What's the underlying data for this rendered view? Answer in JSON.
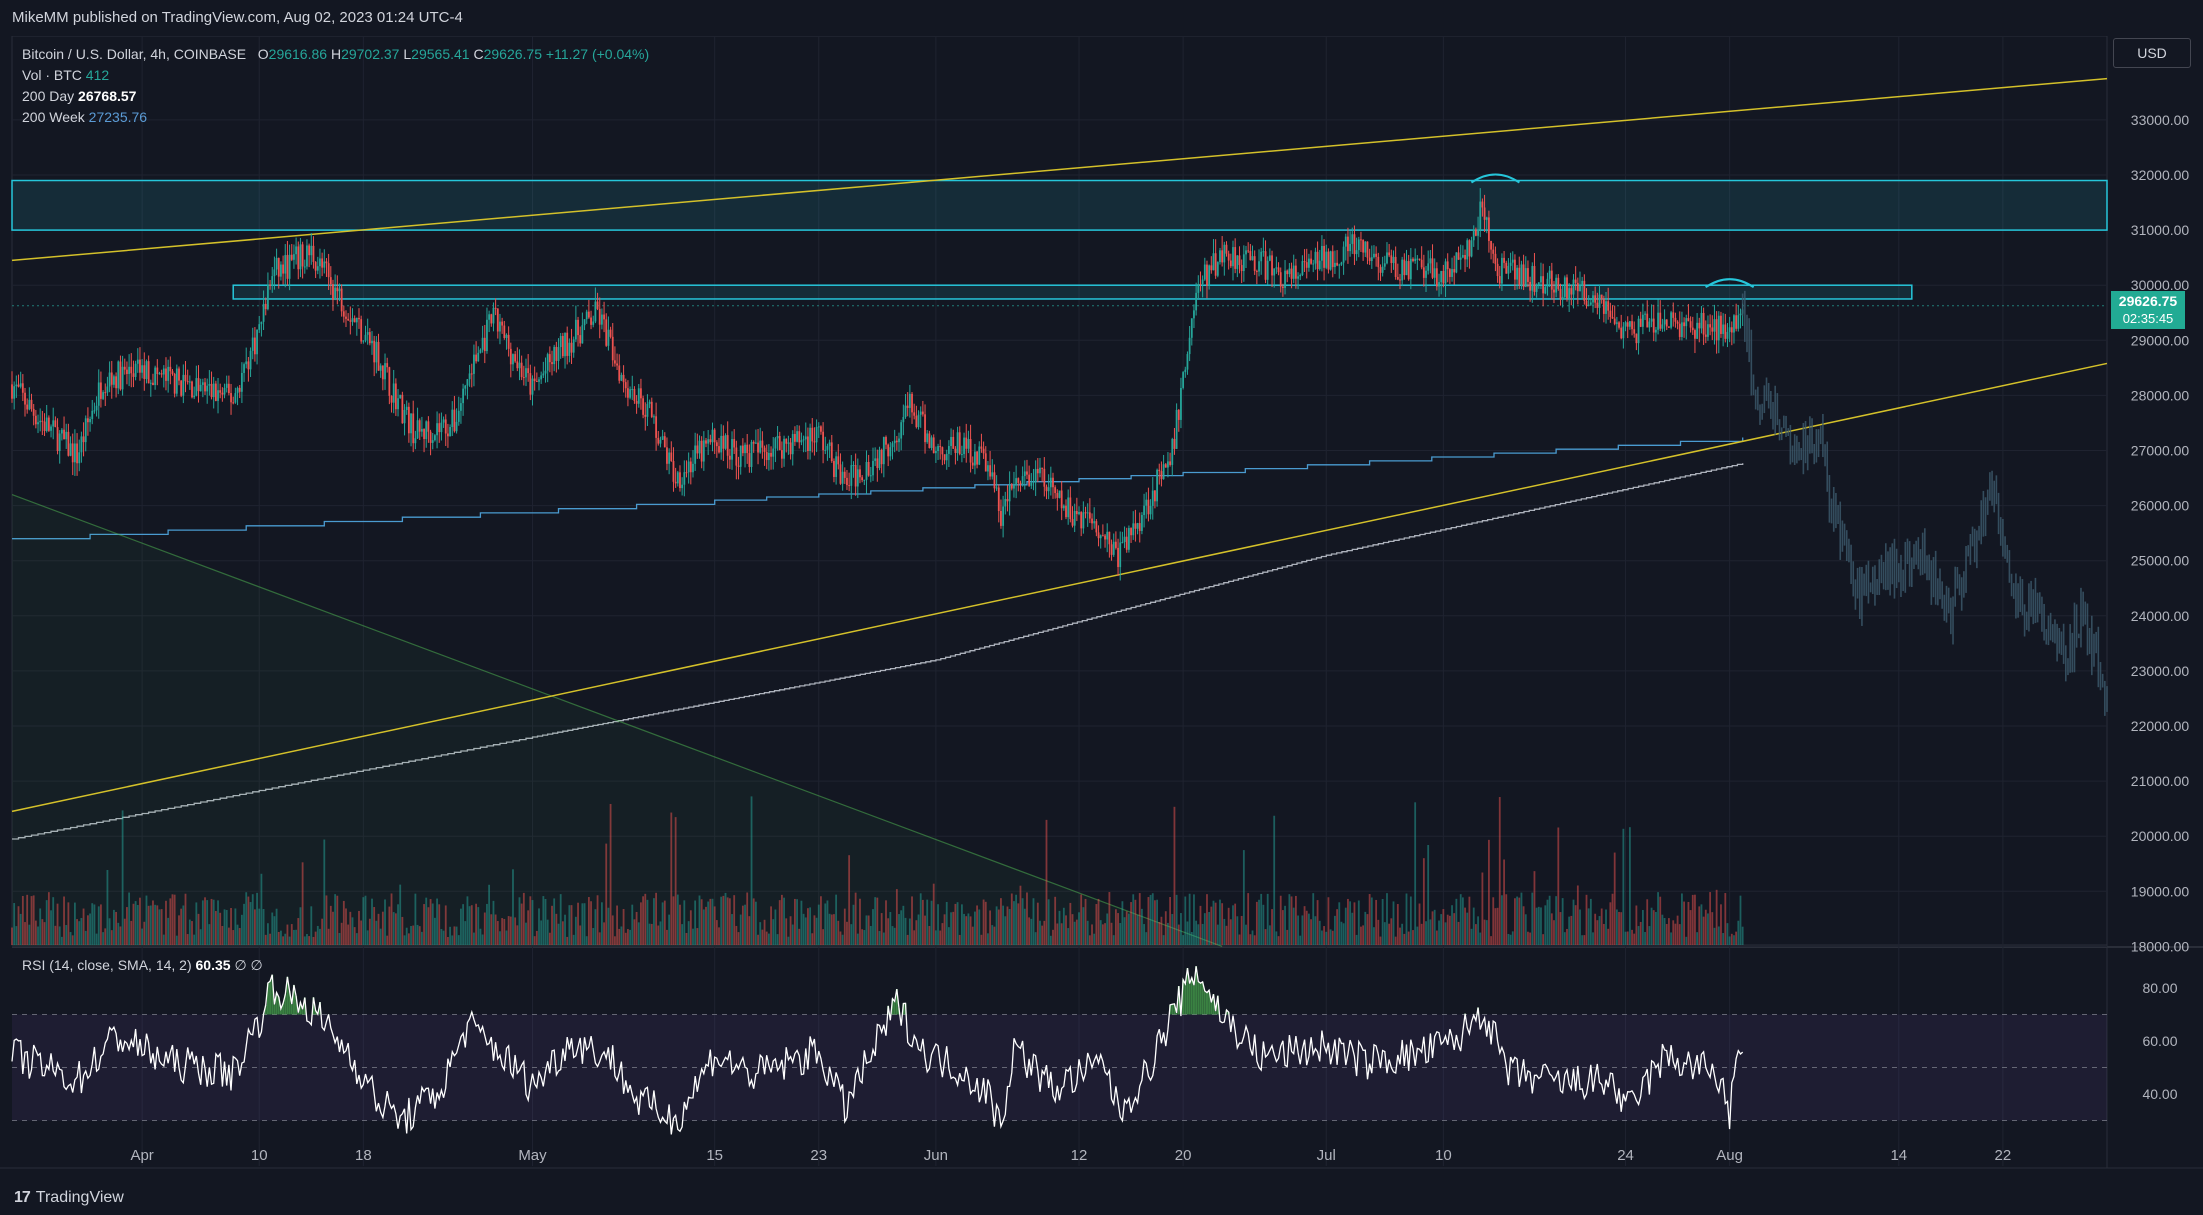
{
  "header": {
    "published": "MikeMM published on TradingView.com, Aug 02, 2023 01:24 UTC-4"
  },
  "legend": {
    "symbol": "Bitcoin / U.S. Dollar, 4h, COINBASE",
    "o_label": "O",
    "o_value": "29616.86",
    "h_label": "H",
    "h_value": "29702.37",
    "l_label": "L",
    "l_value": "29565.41",
    "c_label": "C",
    "c_value": "29626.75",
    "change": "+11.27 (+0.04%)",
    "vol_label": "Vol · BTC",
    "vol_value": "412",
    "ma200d_label": "200 Day",
    "ma200d_value": "26768.57",
    "ma200w_label": "200 Week",
    "ma200w_value": "27235.76"
  },
  "rsi_legend": {
    "label": "RSI (14, close, SMA, 14, 2)",
    "value": "60.35",
    "extra": "∅ ∅"
  },
  "currency": "USD",
  "price_tag": {
    "price": "29626.75",
    "countdown": "02:35:45"
  },
  "footer": {
    "logo": "17",
    "brand": "TradingView"
  },
  "colors": {
    "background": "#131722",
    "up": "#26a69a",
    "down": "#ef5350",
    "zone": "#26c6da",
    "trendline": "#d4c12a",
    "ma200w": "#4a9bd0",
    "ma200d": "#c8ccd6",
    "rsi": "#ffffff",
    "rsi_band": "#7e57c2"
  },
  "chart_data": [
    {
      "type": "candlestick",
      "title": "Bitcoin / U.S. Dollar, 4h, COINBASE",
      "ylim": [
        18000,
        34000
      ],
      "y_ticks": [
        "33000.00",
        "32000.00",
        "31000.00",
        "30000.00",
        "29000.00",
        "28000.00",
        "27000.00",
        "26000.00",
        "25000.00",
        "24000.00",
        "23000.00",
        "22000.00",
        "21000.00",
        "20000.00",
        "19000.00",
        "18000.00"
      ],
      "x_ticks": [
        "Apr",
        "10",
        "18",
        "May",
        "15",
        "23",
        "Jun",
        "12",
        "20",
        "Jul",
        "10",
        "24",
        "Aug",
        "14",
        "22"
      ],
      "x_tick_dates": [
        "2023-04-01",
        "2023-04-10",
        "2023-04-18",
        "2023-05-01",
        "2023-05-15",
        "2023-05-23",
        "2023-06-01",
        "2023-06-12",
        "2023-06-20",
        "2023-07-01",
        "2023-07-10",
        "2023-07-24",
        "2023-08-01",
        "2023-08-14",
        "2023-08-22"
      ],
      "x_range": [
        "2023-03-22",
        "2023-08-30"
      ],
      "close_path": [
        {
          "date": "2023-03-22",
          "close": 28200
        },
        {
          "date": "2023-03-24",
          "close": 27600
        },
        {
          "date": "2023-03-27",
          "close": 26900
        },
        {
          "date": "2023-03-29",
          "close": 28300
        },
        {
          "date": "2023-04-01",
          "close": 28450
        },
        {
          "date": "2023-04-05",
          "close": 28150
        },
        {
          "date": "2023-04-08",
          "close": 27950
        },
        {
          "date": "2023-04-10",
          "close": 29200
        },
        {
          "date": "2023-04-11",
          "close": 30200
        },
        {
          "date": "2023-04-14",
          "close": 30600
        },
        {
          "date": "2023-04-17",
          "close": 29500
        },
        {
          "date": "2023-04-19",
          "close": 28800
        },
        {
          "date": "2023-04-20",
          "close": 28200
        },
        {
          "date": "2023-04-22",
          "close": 27300
        },
        {
          "date": "2023-04-25",
          "close": 27500
        },
        {
          "date": "2023-04-26",
          "close": 28300
        },
        {
          "date": "2023-04-28",
          "close": 29400
        },
        {
          "date": "2023-05-01",
          "close": 28100
        },
        {
          "date": "2023-05-03",
          "close": 28800
        },
        {
          "date": "2023-05-06",
          "close": 29500
        },
        {
          "date": "2023-05-08",
          "close": 28300
        },
        {
          "date": "2023-05-10",
          "close": 27700
        },
        {
          "date": "2023-05-12",
          "close": 26500
        },
        {
          "date": "2023-05-15",
          "close": 27200
        },
        {
          "date": "2023-05-17",
          "close": 26900
        },
        {
          "date": "2023-05-20",
          "close": 27100
        },
        {
          "date": "2023-05-23",
          "close": 27300
        },
        {
          "date": "2023-05-25",
          "close": 26400
        },
        {
          "date": "2023-05-28",
          "close": 27000
        },
        {
          "date": "2023-05-30",
          "close": 27800
        },
        {
          "date": "2023-06-01",
          "close": 27000
        },
        {
          "date": "2023-06-03",
          "close": 27100
        },
        {
          "date": "2023-06-05",
          "close": 26800
        },
        {
          "date": "2023-06-06",
          "close": 25800
        },
        {
          "date": "2023-06-07",
          "close": 26400
        },
        {
          "date": "2023-06-09",
          "close": 26500
        },
        {
          "date": "2023-06-11",
          "close": 25900
        },
        {
          "date": "2023-06-13",
          "close": 25800
        },
        {
          "date": "2023-06-15",
          "close": 25100
        },
        {
          "date": "2023-06-16",
          "close": 25500
        },
        {
          "date": "2023-06-18",
          "close": 26400
        },
        {
          "date": "2023-06-19",
          "close": 26700
        },
        {
          "date": "2023-06-20",
          "close": 28300
        },
        {
          "date": "2023-06-21",
          "close": 29900
        },
        {
          "date": "2023-06-23",
          "close": 30600
        },
        {
          "date": "2023-06-26",
          "close": 30400
        },
        {
          "date": "2023-06-28",
          "close": 30100
        },
        {
          "date": "2023-07-01",
          "close": 30500
        },
        {
          "date": "2023-07-03",
          "close": 30700
        },
        {
          "date": "2023-07-05",
          "close": 30400
        },
        {
          "date": "2023-07-07",
          "close": 30300
        },
        {
          "date": "2023-07-10",
          "close": 30200
        },
        {
          "date": "2023-07-12",
          "close": 30600
        },
        {
          "date": "2023-07-13",
          "close": 31400
        },
        {
          "date": "2023-07-14",
          "close": 30300
        },
        {
          "date": "2023-07-17",
          "close": 30100
        },
        {
          "date": "2023-07-20",
          "close": 29900
        },
        {
          "date": "2023-07-22",
          "close": 29800
        },
        {
          "date": "2023-07-24",
          "close": 29100
        },
        {
          "date": "2023-07-26",
          "close": 29300
        },
        {
          "date": "2023-07-28",
          "close": 29300
        },
        {
          "date": "2023-07-31",
          "close": 29200
        },
        {
          "date": "2023-08-01",
          "close": 29300
        },
        {
          "date": "2023-08-02",
          "close": 29626.75
        }
      ],
      "projection_path": [
        {
          "date": "2023-08-02",
          "close": 29600
        },
        {
          "date": "2023-08-03",
          "close": 28000
        },
        {
          "date": "2023-08-05",
          "close": 27600
        },
        {
          "date": "2023-08-06",
          "close": 26900
        },
        {
          "date": "2023-08-08",
          "close": 27200
        },
        {
          "date": "2023-08-09",
          "close": 25800
        },
        {
          "date": "2023-08-11",
          "close": 24300
        },
        {
          "date": "2023-08-13",
          "close": 24800
        },
        {
          "date": "2023-08-16",
          "close": 25000
        },
        {
          "date": "2023-08-18",
          "close": 24100
        },
        {
          "date": "2023-08-20",
          "close": 25500
        },
        {
          "date": "2023-08-21",
          "close": 26400
        },
        {
          "date": "2023-08-23",
          "close": 24300
        },
        {
          "date": "2023-08-25",
          "close": 24000
        },
        {
          "date": "2023-08-27",
          "close": 23200
        },
        {
          "date": "2023-08-28",
          "close": 24100
        },
        {
          "date": "2023-08-30",
          "close": 22700
        }
      ],
      "zones": [
        {
          "from": "2023-03-22",
          "to": "2023-08-30",
          "low": 31000,
          "high": 31900
        },
        {
          "from": "2023-04-08",
          "to": "2023-08-15",
          "low": 29750,
          "high": 30000
        }
      ],
      "trendlines": [
        {
          "from": {
            "date": "2023-03-22",
            "price": 30450
          },
          "to": {
            "date": "2023-08-30",
            "price": 33750
          }
        },
        {
          "from": {
            "date": "2023-03-22",
            "price": 20450
          },
          "to": {
            "date": "2023-08-30",
            "price": 28580
          }
        },
        {
          "from": {
            "date": "2023-03-22",
            "price": 26200
          },
          "to": {
            "date": "2023-06-23",
            "price": 18000
          }
        }
      ],
      "moving_averages": [
        {
          "name": "200 Week",
          "points": [
            {
              "date": "2023-03-22",
              "price": 25400
            },
            {
              "date": "2023-05-15",
              "price": 26100
            },
            {
              "date": "2023-06-20",
              "price": 26600
            },
            {
              "date": "2023-08-02",
              "price": 27235.76
            }
          ]
        },
        {
          "name": "200 Day",
          "points": [
            {
              "date": "2023-03-22",
              "price": 19950
            },
            {
              "date": "2023-05-01",
              "price": 21800
            },
            {
              "date": "2023-06-01",
              "price": 23200
            },
            {
              "date": "2023-07-01",
              "price": 25100
            },
            {
              "date": "2023-08-02",
              "price": 26768.57
            }
          ]
        }
      ],
      "last_price": 29626.75
    },
    {
      "type": "line",
      "title": "RSI (14, close, SMA, 14, 2)",
      "ylim": [
        30,
        90
      ],
      "y_ticks": [
        "80.00",
        "60.00",
        "40.00"
      ],
      "bands": {
        "upper": 70,
        "middle": 50,
        "lower": 30
      },
      "path": [
        {
          "date": "2023-03-22",
          "value": 55
        },
        {
          "date": "2023-03-27",
          "value": 45
        },
        {
          "date": "2023-03-30",
          "value": 62
        },
        {
          "date": "2023-04-03",
          "value": 52
        },
        {
          "date": "2023-04-08",
          "value": 48
        },
        {
          "date": "2023-04-10",
          "value": 68
        },
        {
          "date": "2023-04-11",
          "value": 81
        },
        {
          "date": "2023-04-14",
          "value": 72
        },
        {
          "date": "2023-04-17",
          "value": 55
        },
        {
          "date": "2023-04-19",
          "value": 38
        },
        {
          "date": "2023-04-21",
          "value": 30
        },
        {
          "date": "2023-04-24",
          "value": 42
        },
        {
          "date": "2023-04-26",
          "value": 66
        },
        {
          "date": "2023-04-28",
          "value": 58
        },
        {
          "date": "2023-05-01",
          "value": 43
        },
        {
          "date": "2023-05-04",
          "value": 60
        },
        {
          "date": "2023-05-07",
          "value": 54
        },
        {
          "date": "2023-05-09",
          "value": 38
        },
        {
          "date": "2023-05-12",
          "value": 30
        },
        {
          "date": "2023-05-15",
          "value": 55
        },
        {
          "date": "2023-05-18",
          "value": 47
        },
        {
          "date": "2023-05-23",
          "value": 56
        },
        {
          "date": "2023-05-25",
          "value": 35
        },
        {
          "date": "2023-05-29",
          "value": 74
        },
        {
          "date": "2023-05-31",
          "value": 56
        },
        {
          "date": "2023-06-03",
          "value": 49
        },
        {
          "date": "2023-06-05",
          "value": 40
        },
        {
          "date": "2023-06-06",
          "value": 28
        },
        {
          "date": "2023-06-07",
          "value": 58
        },
        {
          "date": "2023-06-10",
          "value": 42
        },
        {
          "date": "2023-06-14",
          "value": 52
        },
        {
          "date": "2023-06-15",
          "value": 33
        },
        {
          "date": "2023-06-17",
          "value": 46
        },
        {
          "date": "2023-06-19",
          "value": 68
        },
        {
          "date": "2023-06-21",
          "value": 87
        },
        {
          "date": "2023-06-23",
          "value": 70
        },
        {
          "date": "2023-06-26",
          "value": 54
        },
        {
          "date": "2023-07-01",
          "value": 58
        },
        {
          "date": "2023-07-04",
          "value": 52
        },
        {
          "date": "2023-07-08",
          "value": 55
        },
        {
          "date": "2023-07-11",
          "value": 60
        },
        {
          "date": "2023-07-13",
          "value": 72
        },
        {
          "date": "2023-07-15",
          "value": 48
        },
        {
          "date": "2023-07-19",
          "value": 44
        },
        {
          "date": "2023-07-23",
          "value": 45
        },
        {
          "date": "2023-07-24",
          "value": 33
        },
        {
          "date": "2023-07-27",
          "value": 54
        },
        {
          "date": "2023-07-31",
          "value": 48
        },
        {
          "date": "2023-08-01",
          "value": 33
        },
        {
          "date": "2023-08-02",
          "value": 61
        }
      ],
      "last_value": 60.35
    }
  ]
}
